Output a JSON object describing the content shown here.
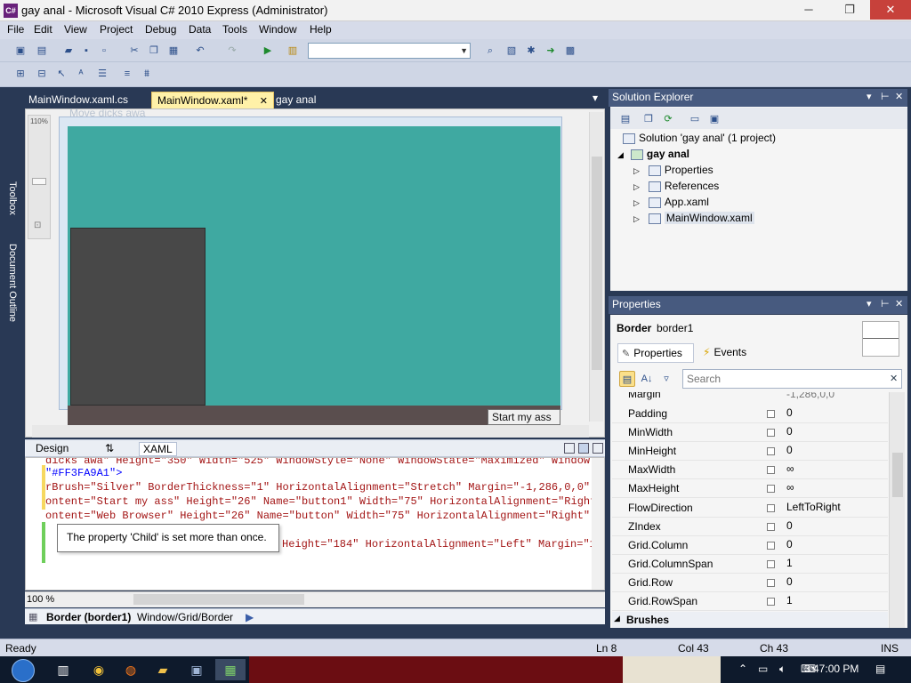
{
  "window": {
    "title": "gay anal - Microsoft Visual C# 2010 Express (Administrator)",
    "minimize": "─",
    "maximize": "❐",
    "close": "✕",
    "app_icon": "C#"
  },
  "menu": [
    "File",
    "Edit",
    "View",
    "Project",
    "Debug",
    "Data",
    "Tools",
    "Window",
    "Help"
  ],
  "side_tabs": {
    "toolbox": "Toolbox",
    "doc_outline": "Document Outline"
  },
  "doc_tabs": {
    "tab1": "MainWindow.xaml.cs",
    "tab2": "MainWindow.xaml*",
    "tab3": "gay anal",
    "close_glyph": "✕",
    "dropdown_glyph": "▾"
  },
  "designer": {
    "zoom_label": "110%",
    "hidden_title": "Move dicks awa",
    "button_text": "Start my ass"
  },
  "split_tabs": {
    "design": "Design",
    "swap": "⇅",
    "xaml": "XAML"
  },
  "code": {
    "line1": "dicks awa\" Height=\"350\" Width=\"525\" WindowStyle=\"None\" WindowState=\"Maximized\" Window",
    "line2": "\"#FF3FA9A1\">",
    "line3": "rBrush=\"Silver\" BorderThickness=\"1\" HorizontalAlignment=\"Stretch\" Margin=\"-1,286,0,0\"",
    "line4": "ontent=\"Start my ass\" Height=\"26\" Name=\"button1\" Width=\"75\" HorizontalAlignment=\"Right",
    "line5": "ontent=\"Web Browser\" Height=\"26\" Name=\"button\" Width=\"75\" HorizontalAlignment=\"Right\"",
    "line6": "Height=\"184\" HorizontalAlignment=\"Left\" Margin=\"1",
    "tooltip": "The property 'Child' is set more than once.",
    "zoom": "100 %"
  },
  "breadcrumb": {
    "element": "Border (border1)",
    "path": "Window/Grid/Border"
  },
  "solution_explorer": {
    "title": "Solution Explorer",
    "solution": "Solution 'gay anal' (1 project)",
    "project": "gay anal",
    "items": [
      "Properties",
      "References",
      "App.xaml",
      "MainWindow.xaml"
    ]
  },
  "properties": {
    "title": "Properties",
    "type": "Border",
    "name": "border1",
    "tab_properties": "Properties",
    "tab_events": "Events",
    "search_placeholder": "Search",
    "partial_row": "Margin",
    "partial_val": "-1,286,0,0",
    "rows": [
      {
        "name": "Padding",
        "value": "0"
      },
      {
        "name": "MinWidth",
        "value": "0"
      },
      {
        "name": "MinHeight",
        "value": "0"
      },
      {
        "name": "MaxWidth",
        "value": "∞"
      },
      {
        "name": "MaxHeight",
        "value": "∞"
      },
      {
        "name": "FlowDirection",
        "value": "LeftToRight"
      },
      {
        "name": "ZIndex",
        "value": "0"
      },
      {
        "name": "Grid.Column",
        "value": "0"
      },
      {
        "name": "Grid.ColumnSpan",
        "value": "1"
      },
      {
        "name": "Grid.Row",
        "value": "0"
      },
      {
        "name": "Grid.RowSpan",
        "value": "1"
      }
    ],
    "category": "Brushes"
  },
  "status": {
    "ready": "Ready",
    "ln": "Ln 8",
    "col": "Col 43",
    "ch": "Ch 43",
    "ins": "INS"
  },
  "taskbar": {
    "time": "3:47:00 PM"
  },
  "colors": {
    "teal": "#3FA9A1",
    "accent_tab": "#FFF1A8",
    "pane_header": "#475A7F"
  }
}
